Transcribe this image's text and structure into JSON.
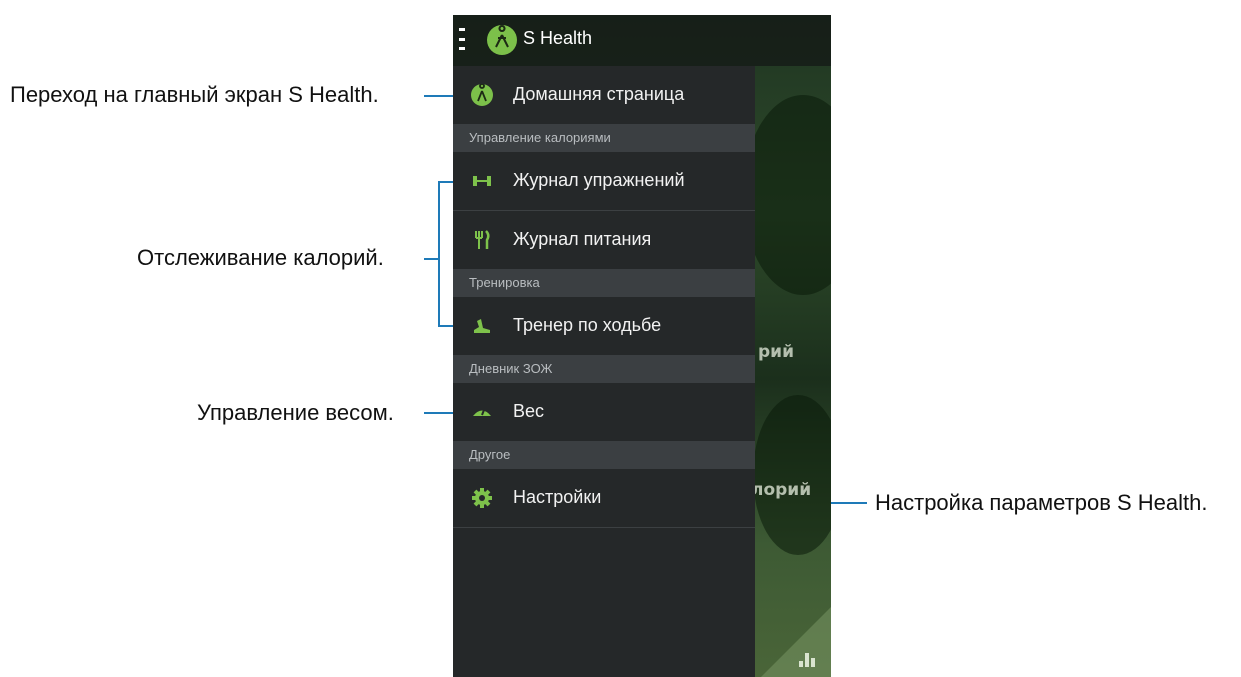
{
  "app": {
    "title": "S Health"
  },
  "drawer": {
    "home": "Домашняя страница",
    "sections": {
      "calories": "Управление калориями",
      "training": "Тренировка",
      "diary": "Дневник ЗОЖ",
      "other": "Другое"
    },
    "items": {
      "exercise": "Журнал упражнений",
      "food": "Журнал питания",
      "walking": "Тренер по ходьбе",
      "weight": "Вес",
      "settings": "Настройки"
    }
  },
  "background": {
    "label1": "рий",
    "label2": "лорий"
  },
  "callouts": {
    "home": "Переход на главный экран S Health.",
    "calories": "Отслеживание калорий.",
    "weight": "Управление весом.",
    "settings": "Настройка параметров S Health."
  },
  "colors": {
    "accent": "#7ec24b",
    "callout_line": "#1e7ab8",
    "drawer_bg": "#252829"
  }
}
